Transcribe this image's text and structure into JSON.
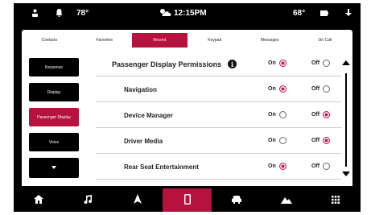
{
  "status": {
    "outside_temp": "78°",
    "clock": "12:15PM",
    "inside_temp": "68°"
  },
  "tabs": [
    {
      "label": "Contacts"
    },
    {
      "label": "Favorites"
    },
    {
      "label": "Recent",
      "active": true
    },
    {
      "label": "Keypad"
    },
    {
      "label": "Messages"
    },
    {
      "label": "On Call"
    }
  ],
  "sidebar": [
    {
      "label": "Keysense"
    },
    {
      "label": "Display"
    },
    {
      "label": "Passenger Display",
      "active": true
    },
    {
      "label": "Voice"
    }
  ],
  "permissions": {
    "title": "Passenger Display Permissions",
    "on_label": "On",
    "off_label": "Off",
    "header_selected": "on",
    "rows": [
      {
        "label": "Navigation",
        "selected": "on"
      },
      {
        "label": "Device Manager",
        "selected": "off"
      },
      {
        "label": "Driver Media",
        "selected": "off"
      },
      {
        "label": "Rear Seat Entertainment",
        "selected": "on"
      }
    ]
  },
  "bottom_nav": [
    {
      "icon": "home-icon"
    },
    {
      "icon": "music-icon"
    },
    {
      "icon": "navigation-icon"
    },
    {
      "icon": "phone-icon",
      "active": true
    },
    {
      "icon": "vehicle-icon"
    },
    {
      "icon": "apps-icon"
    },
    {
      "icon": "grid-icon"
    }
  ],
  "colors": {
    "accent": "#b5123e",
    "radio_selected": "#c2184d"
  }
}
